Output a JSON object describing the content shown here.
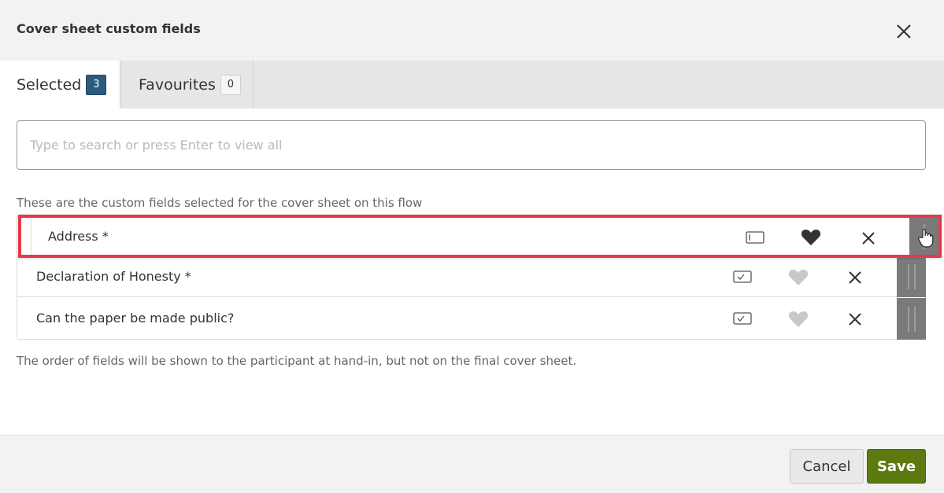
{
  "dialog": {
    "title": "Cover sheet custom fields",
    "close_icon": "close-icon"
  },
  "tabs": [
    {
      "label": "Selected",
      "count": "3",
      "active": true
    },
    {
      "label": "Favourites",
      "count": "0",
      "active": false
    }
  ],
  "search": {
    "placeholder": "Type to search or press Enter to view all",
    "value": ""
  },
  "intro_text": "These are the custom fields selected for the cover sheet on this flow",
  "fields": [
    {
      "label": "Address *",
      "type_icon": "text-field-icon",
      "favourite": true,
      "dragging": true
    },
    {
      "label": "Declaration of Honesty *",
      "type_icon": "checkbox-field-icon",
      "favourite": false,
      "dragging": false
    },
    {
      "label": "Can the paper be made public?",
      "type_icon": "checkbox-field-icon",
      "favourite": false,
      "dragging": false
    }
  ],
  "note": "The order of fields will be shown to the participant at hand-in, but not on the final cover sheet.",
  "footer": {
    "cancel_label": "Cancel",
    "save_label": "Save"
  },
  "colors": {
    "badge_active": "#2b5b80",
    "save_button": "#5c7a0f",
    "drag_highlight": "#e23b47",
    "drag_handle": "#7a7a7a",
    "heart_active": "#333333",
    "heart_inactive": "#c8c8c8"
  }
}
